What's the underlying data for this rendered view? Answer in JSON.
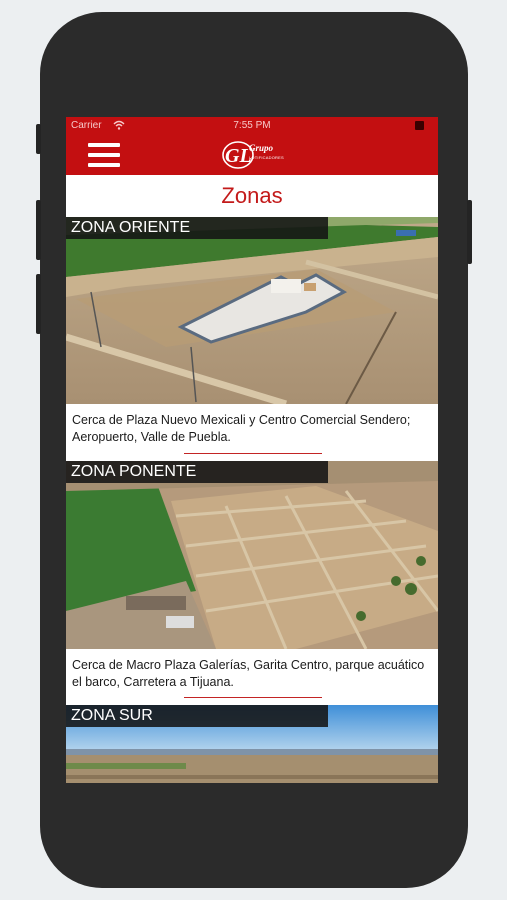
{
  "status_bar": {
    "carrier": "Carrier",
    "time": "7:55 PM"
  },
  "header": {
    "logo_monogram": "GL",
    "logo_brand": "Grupo",
    "logo_sub": "LOTIFICADORES"
  },
  "page_title": "Zonas",
  "zones": [
    {
      "label": "ZONA ORIENTE",
      "description": "Cerca de Plaza Nuevo Mexicali y Centro Comercial Sendero; Aeropuerto, Valle de Puebla."
    },
    {
      "label": "ZONA PONENTE",
      "description": "Cerca de Macro Plaza Galerías, Garita Centro, parque acuático el barco, Carretera a Tijuana."
    },
    {
      "label": "ZONA SUR",
      "description": ""
    }
  ],
  "colors": {
    "brand_red": "#c30f11",
    "title_red": "#c31a1a",
    "phone_body": "#2b2b2b",
    "background": "#eceff1"
  },
  "icons": [
    "wifi-icon",
    "battery-icon",
    "hamburger-menu-icon",
    "logo-mark-icon"
  ]
}
